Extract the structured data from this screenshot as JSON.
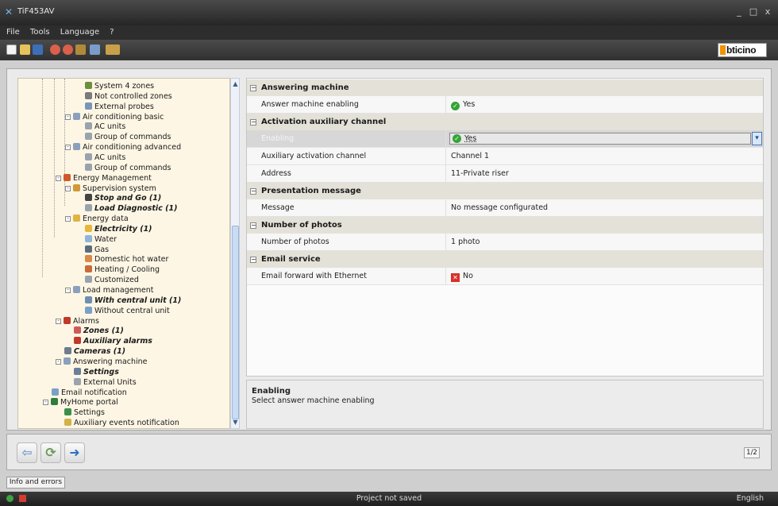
{
  "window": {
    "title": "TiF453AV",
    "minimize": "_",
    "maximize": "□",
    "close": "x"
  },
  "menu": [
    "File",
    "Tools",
    "Language",
    "?"
  ],
  "toolbar": {
    "icons": [
      "new-file-icon",
      "open-folder-icon",
      "save-icon",
      "send-icon",
      "receive-icon",
      "tools-icon",
      "user-icon",
      "chart-icon"
    ],
    "brand": "bticino"
  },
  "tree": {
    "items": [
      {
        "label": "System 4 zones",
        "level": 3,
        "bold": false,
        "icon_color": "#6a8f3d"
      },
      {
        "label": "Not controlled zones",
        "level": 3,
        "bold": false,
        "icon_color": "#7b7b7b"
      },
      {
        "label": "External probes",
        "level": 3,
        "bold": false,
        "icon_color": "#7b95b8"
      },
      {
        "label": "Air conditioning basic",
        "level": 2,
        "bold": false,
        "icon_color": "#8aa0bd",
        "expander": "-"
      },
      {
        "label": "AC units",
        "level": 3,
        "bold": false,
        "icon_color": "#9aa3ad"
      },
      {
        "label": "Group of commands",
        "level": 3,
        "bold": false,
        "icon_color": "#9aa3ad"
      },
      {
        "label": "Air conditioning advanced",
        "level": 2,
        "bold": false,
        "icon_color": "#8aa0bd",
        "expander": "-"
      },
      {
        "label": "AC units",
        "level": 3,
        "bold": false,
        "icon_color": "#9aa3ad"
      },
      {
        "label": "Group of commands",
        "level": 3,
        "bold": false,
        "icon_color": "#9aa3ad"
      },
      {
        "label": "Energy Management",
        "level": 1,
        "bold": false,
        "icon_color": "#d0582b",
        "expander": "-"
      },
      {
        "label": "Supervision system",
        "level": 2,
        "bold": false,
        "icon_color": "#d09a3a",
        "expander": "-"
      },
      {
        "label": "Stop and Go (1)",
        "level": 3,
        "bold": true,
        "icon_color": "#444444"
      },
      {
        "label": "Load Diagnostic (1)",
        "level": 3,
        "bold": true,
        "icon_color": "#9aa3ad"
      },
      {
        "label": "Energy data",
        "level": 2,
        "bold": false,
        "icon_color": "#e0b343",
        "expander": "-"
      },
      {
        "label": "Electricity (1)",
        "level": 3,
        "bold": true,
        "icon_color": "#e6b73a"
      },
      {
        "label": "Water",
        "level": 3,
        "bold": false,
        "icon_color": "#8fb6da"
      },
      {
        "label": "Gas",
        "level": 3,
        "bold": false,
        "icon_color": "#5d6b7a"
      },
      {
        "label": "Domestic hot water",
        "level": 3,
        "bold": false,
        "icon_color": "#d88a4a"
      },
      {
        "label": "Heating / Cooling",
        "level": 3,
        "bold": false,
        "icon_color": "#c96b3a"
      },
      {
        "label": "Customized",
        "level": 3,
        "bold": false,
        "icon_color": "#9aa3ad"
      },
      {
        "label": "Load management",
        "level": 2,
        "bold": false,
        "icon_color": "#8aa0bd",
        "expander": "-"
      },
      {
        "label": "With central unit (1)",
        "level": 3,
        "bold": true,
        "icon_color": "#6f8fb0"
      },
      {
        "label": "Without central unit",
        "level": 3,
        "bold": false,
        "icon_color": "#7c9fc7"
      },
      {
        "label": "Alarms",
        "level": 1,
        "bold": false,
        "icon_color": "#c0392b",
        "expander": "-"
      },
      {
        "label": "Zones (1)",
        "level": 2,
        "bold": true,
        "icon_color": "#d05a5a"
      },
      {
        "label": "Auxiliary alarms",
        "level": 2,
        "bold": true,
        "icon_color": "#c0392b"
      },
      {
        "label": "Cameras (1)",
        "level": 1,
        "bold": true,
        "icon_color": "#6d7d8d"
      },
      {
        "label": "Answering machine",
        "level": 1,
        "bold": false,
        "icon_color": "#8aa0bd",
        "expander": "-"
      },
      {
        "label": "Settings",
        "level": 2,
        "bold": true,
        "icon_color": "#6a7f99"
      },
      {
        "label": "External Units",
        "level": 2,
        "bold": false,
        "icon_color": "#9aa3ad"
      },
      {
        "label": "Email notification",
        "level": 0,
        "bold": false,
        "icon_color": "#7c9fc7"
      },
      {
        "label": "MyHome portal",
        "level": 0,
        "bold": false,
        "icon_color": "#2f7d3a",
        "expander": "-"
      },
      {
        "label": "Settings",
        "level": 1,
        "bold": false,
        "icon_color": "#3a8f4a"
      },
      {
        "label": "Auxiliary events notification",
        "level": 1,
        "bold": false,
        "icon_color": "#d0b34a"
      }
    ]
  },
  "properties": {
    "sections": [
      {
        "title": "Answering machine",
        "rows": [
          {
            "key": "Answer machine enabling",
            "value": "Yes",
            "icon": "ok"
          }
        ]
      },
      {
        "title": "Activation auxiliary channel",
        "rows": [
          {
            "key": "Enabling",
            "value": "Yes",
            "icon": "ok",
            "selected": true
          },
          {
            "key": "Auxiliary activation channel",
            "value": "Channel 1"
          },
          {
            "key": "Address",
            "value": "11-Private riser"
          }
        ]
      },
      {
        "title": "Presentation message",
        "rows": [
          {
            "key": "Message",
            "value": "No message configurated"
          }
        ]
      },
      {
        "title": "Number of photos",
        "rows": [
          {
            "key": "Number of photos",
            "value": "1 photo"
          }
        ]
      },
      {
        "title": "Email service",
        "rows": [
          {
            "key": "Email forward with Ethernet",
            "value": "No",
            "icon": "no"
          }
        ]
      }
    ]
  },
  "description": {
    "title": "Enabling",
    "text": "Select answer machine enabling"
  },
  "nav": {
    "back_icon": "arrow-left-icon",
    "refresh_icon": "refresh-icon",
    "forward_icon": "arrow-right-icon",
    "page": "1/2"
  },
  "info_tab": "Info and errors",
  "status": {
    "text": "Project not saved",
    "language": "English"
  },
  "colors": {
    "tree_bg": "#fdf6e4",
    "section_bg": "#e4e1d8",
    "ok": "#35a435",
    "no": "#d8302a",
    "brand_accent": "#f39200"
  }
}
